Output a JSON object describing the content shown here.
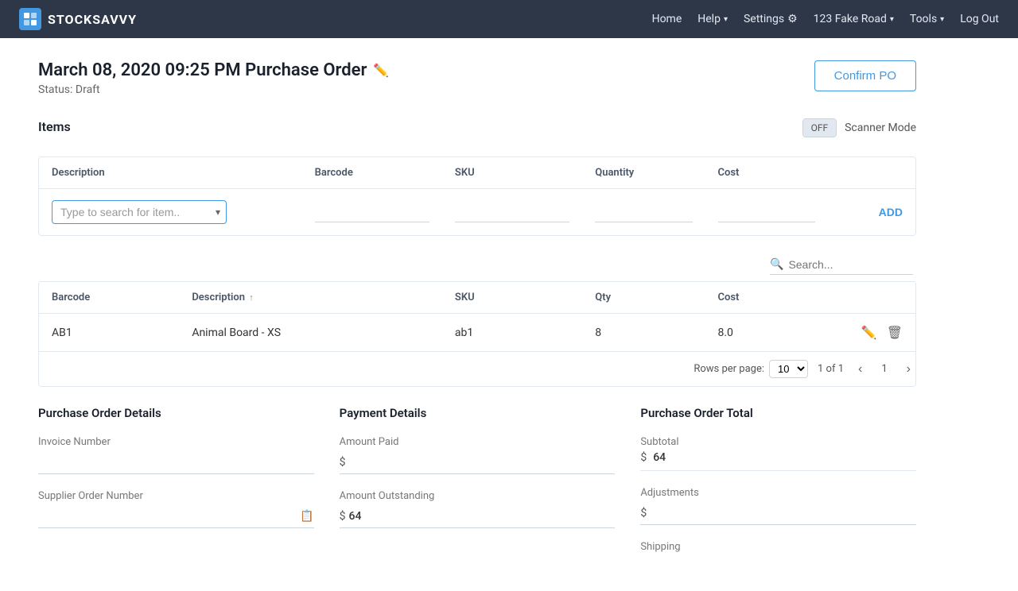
{
  "brand": {
    "icon": "SS",
    "name": "STOCKSAVVY"
  },
  "nav": {
    "home": "Home",
    "help": "Help",
    "settings": "Settings",
    "location": "123 Fake Road",
    "tools": "Tools",
    "logout": "Log Out"
  },
  "page": {
    "title": "March 08, 2020 09:25 PM Purchase Order",
    "status_label": "Status:",
    "status_value": "Draft",
    "confirm_btn": "Confirm PO"
  },
  "items": {
    "section_title": "Items",
    "scanner_mode_label": "Scanner Mode",
    "toggle_off": "OFF",
    "search_placeholder": "Type to search for item..",
    "add_btn": "ADD",
    "columns": [
      {
        "key": "description",
        "label": "Description",
        "sortable": false
      },
      {
        "key": "barcode",
        "label": "Barcode",
        "sortable": false
      },
      {
        "key": "sku",
        "label": "SKU",
        "sortable": false
      },
      {
        "key": "quantity",
        "label": "Quantity",
        "sortable": false
      },
      {
        "key": "cost",
        "label": "Cost",
        "sortable": false
      }
    ]
  },
  "results": {
    "search_placeholder": "Search...",
    "columns": [
      {
        "key": "barcode",
        "label": "Barcode",
        "sortable": false
      },
      {
        "key": "description",
        "label": "Description",
        "sortable": true
      },
      {
        "key": "sku",
        "label": "SKU",
        "sortable": false
      },
      {
        "key": "qty",
        "label": "Qty",
        "sortable": false
      },
      {
        "key": "cost",
        "label": "Cost",
        "sortable": false
      }
    ],
    "rows": [
      {
        "barcode": "AB1",
        "description": "Animal Board - XS",
        "sku": "ab1",
        "qty": "8",
        "cost": "8.0"
      }
    ],
    "pagination": {
      "rows_per_page_label": "Rows per page:",
      "rows_per_page_value": "10",
      "page_info": "1 of 1",
      "current_page": "1"
    }
  },
  "purchase_order_details": {
    "title": "Purchase Order Details",
    "invoice_number_label": "Invoice Number",
    "invoice_number_value": "",
    "supplier_order_label": "Supplier Order Number",
    "supplier_order_value": ""
  },
  "payment_details": {
    "title": "Payment Details",
    "amount_paid_label": "Amount Paid",
    "amount_paid_prefix": "$",
    "amount_paid_value": "",
    "amount_outstanding_label": "Amount Outstanding",
    "amount_outstanding_prefix": "$",
    "amount_outstanding_value": "64"
  },
  "purchase_order_total": {
    "title": "Purchase Order Total",
    "subtotal_label": "Subtotal",
    "subtotal_prefix": "$",
    "subtotal_value": "64",
    "adjustments_label": "Adjustments",
    "adjustments_prefix": "$",
    "adjustments_value": "",
    "shipping_label": "Shipping"
  }
}
